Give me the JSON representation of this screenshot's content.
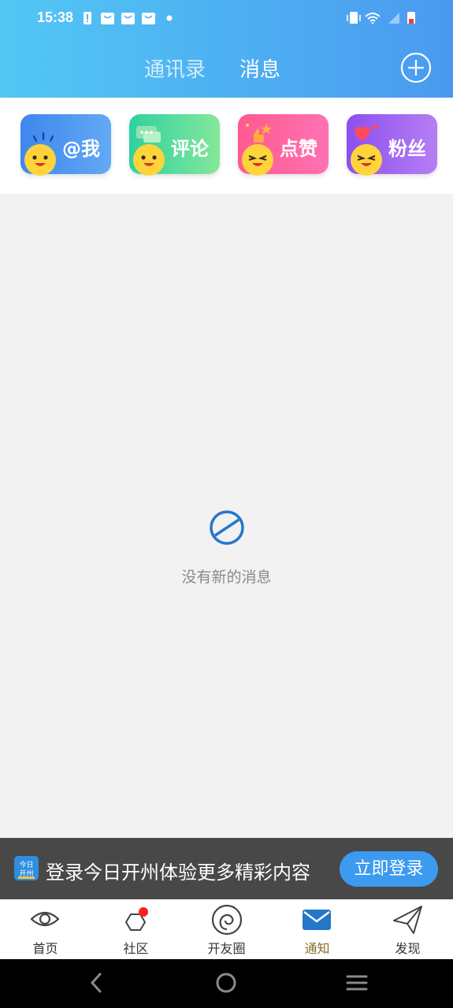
{
  "status_bar": {
    "time": "15:38"
  },
  "header": {
    "tabs": [
      {
        "label": "通讯录",
        "active": false
      },
      {
        "label": "消息",
        "active": true
      }
    ],
    "add_icon": "plus-circle-icon"
  },
  "quick_cards": [
    {
      "label": "@我",
      "gradient": [
        "#3f86ef",
        "#62a9f5"
      ],
      "icon": "face-icon"
    },
    {
      "label": "评论",
      "gradient": [
        "#2fd0a0",
        "#84e89a"
      ],
      "icon": "face-icon"
    },
    {
      "label": "点赞",
      "gradient": [
        "#ff5a8e",
        "#ff72b4"
      ],
      "icon": "face-icon"
    },
    {
      "label": "粉丝",
      "gradient": [
        "#8b50ee",
        "#b67ef5"
      ],
      "icon": "face-icon"
    }
  ],
  "empty_state": {
    "icon": "no-entry-icon",
    "text": "没有新的消息"
  },
  "login_banner": {
    "text": "登录今日开州体验更多精彩内容",
    "button": "立即登录",
    "logo_text": "今日开州"
  },
  "bottom_tabs": [
    {
      "label": "首页",
      "icon": "eye-icon",
      "active": false
    },
    {
      "label": "社区",
      "icon": "hexagon-icon",
      "active": false,
      "badge": true
    },
    {
      "label": "开友圈",
      "icon": "spiral-icon",
      "active": false
    },
    {
      "label": "通知",
      "icon": "envelope-icon",
      "active": true
    },
    {
      "label": "发现",
      "icon": "paper-plane-icon",
      "active": false
    }
  ],
  "colors": {
    "accent": "#4a9af0",
    "active_tab_label": "#8a6d2e",
    "badge": "#ff2020"
  }
}
